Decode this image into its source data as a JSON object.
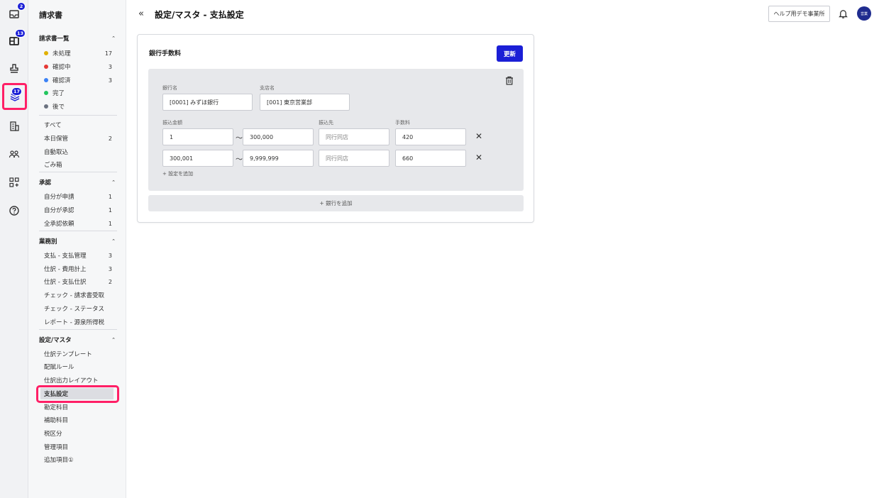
{
  "rail": {
    "badges": {
      "inbox": "2",
      "split": "13",
      "layers": "17"
    }
  },
  "sidebar": {
    "title": "請求書",
    "list_section": {
      "label": "請求書一覧",
      "items": [
        {
          "label": "未処理",
          "count": "17",
          "color": "#e0b000"
        },
        {
          "label": "確認中",
          "count": "3",
          "color": "#e53935"
        },
        {
          "label": "確認済",
          "count": "3",
          "color": "#3b82f6"
        },
        {
          "label": "完了",
          "count": "",
          "color": "#22c55e"
        },
        {
          "label": "後で",
          "count": "",
          "color": "#6b7280"
        }
      ],
      "extra": [
        {
          "label": "すべて",
          "count": ""
        },
        {
          "label": "本日保管",
          "count": "2"
        },
        {
          "label": "自動取込",
          "count": ""
        },
        {
          "label": "ごみ箱",
          "count": ""
        }
      ]
    },
    "approval_section": {
      "label": "承認",
      "items": [
        {
          "label": "自分が申請",
          "count": "1"
        },
        {
          "label": "自分が承認",
          "count": "1"
        },
        {
          "label": "全承認依頼",
          "count": "1"
        }
      ]
    },
    "business_section": {
      "label": "業務別",
      "items": [
        {
          "label": "支払 - 支払管理",
          "count": "3"
        },
        {
          "label": "仕訳 - 費用計上",
          "count": "3"
        },
        {
          "label": "仕訳 - 支払仕訳",
          "count": "2"
        },
        {
          "label": "チェック - 請求書受取",
          "count": ""
        },
        {
          "label": "チェック - ステータス",
          "count": ""
        },
        {
          "label": "レポート - 源泉所得税",
          "count": ""
        }
      ]
    },
    "settings_section": {
      "label": "設定/マスタ",
      "items": [
        {
          "label": "仕訳テンプレート"
        },
        {
          "label": "配賦ルール"
        },
        {
          "label": "仕訳出力レイアウト"
        },
        {
          "label": "支払設定"
        },
        {
          "label": "勘定科目"
        },
        {
          "label": "補助科目"
        },
        {
          "label": "税区分"
        },
        {
          "label": "管理項目"
        },
        {
          "label": "追加項目①"
        }
      ]
    }
  },
  "header": {
    "back_icon": "«",
    "title": "設定/マスタ - 支払設定",
    "help_button": "ヘルプ用デモ事業所",
    "avatar_text": "営業"
  },
  "card": {
    "title": "銀行手数料",
    "update_button": "更新",
    "bank": {
      "bank_name_label": "銀行名",
      "bank_name_value": "[0001] みずほ銀行",
      "branch_label": "支店名",
      "branch_value": "[001] 東京営業部",
      "amount_label": "振込金額",
      "dest_label": "振込先",
      "fee_label": "手数料",
      "rows": [
        {
          "from": "1",
          "to": "300,000",
          "dest": "同行同店",
          "fee": "420"
        },
        {
          "from": "300,001",
          "to": "9,999,999",
          "dest": "同行同店",
          "fee": "660"
        }
      ],
      "tilde": "〜",
      "add_setting": "+ 設定を追加"
    },
    "add_bank": "+ 銀行を追加"
  }
}
